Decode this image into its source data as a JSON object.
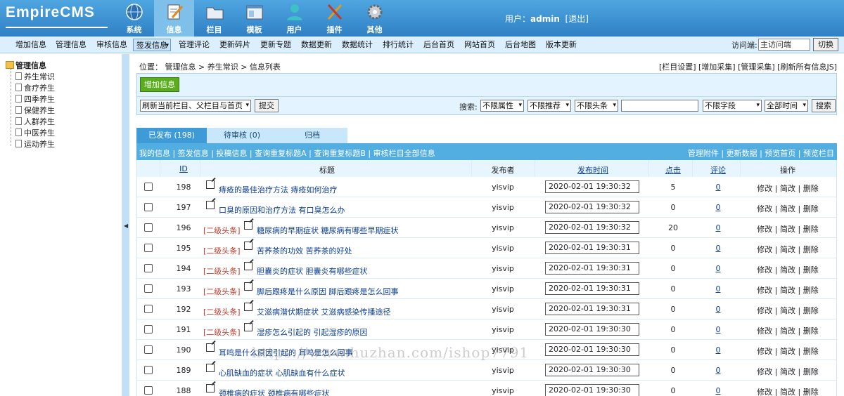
{
  "logo": "EmpireCMS",
  "topnav": [
    {
      "label": "系统",
      "icon": "globe-icon",
      "active": false
    },
    {
      "label": "信息",
      "icon": "pencil-note-icon",
      "active": true
    },
    {
      "label": "栏目",
      "icon": "folder-icon",
      "active": false
    },
    {
      "label": "模板",
      "icon": "window-icon",
      "active": false
    },
    {
      "label": "用户",
      "icon": "user-icon",
      "active": false
    },
    {
      "label": "插件",
      "icon": "tools-icon",
      "active": false
    },
    {
      "label": "其他",
      "icon": "gear-icon",
      "active": false
    }
  ],
  "user": {
    "prefix": "用户：",
    "name": "admin",
    "logout": "[退出]"
  },
  "menubar": {
    "items": [
      "增加信息",
      "管理信息",
      "审核信息",
      "签发信息",
      "管理评论",
      "更新碎片",
      "更新专题",
      "数据更新",
      "数据统计",
      "排行统计",
      "后台首页",
      "网站首页",
      "后台地图",
      "版本更新"
    ],
    "selected": "签发信息",
    "visit_label": "访问端:",
    "visit_value": "主访问端",
    "switch_label": "切换"
  },
  "tree": {
    "root": "管理信息",
    "items": [
      "养生常识",
      "食疗养生",
      "四季养生",
      "保健养生",
      "人群养生",
      "中医养生",
      "运动养生"
    ]
  },
  "breadcrumb": "位置： 管理信息 > 养生常识 > 信息列表",
  "toplinks": "[栏目设置] [增加采集] [管理采集] [刷新所有信息JS]",
  "toolbar": {
    "add_button": "增加信息",
    "refresh_select": "刷新当前栏目、父栏目与首页",
    "submit": "提交",
    "search_label": "搜索:",
    "filters": [
      "不限属性",
      "不限推荐",
      "不限头条"
    ],
    "field_select": "不限字段",
    "time_select": "全部时间",
    "search_button": "搜索"
  },
  "tabs": [
    "已发布 (198)",
    "待审核 (0)",
    "归档"
  ],
  "table_header": {
    "left": "我的信息 | 签发信息 | 投稿信息 | 查询重复标题A | 查询重复标题B | 审核栏目全部信息",
    "right": "管理附件 | 更新数据 | 预览首页 | 预览栏目"
  },
  "columns": [
    "ID",
    "标题",
    "发布者",
    "发布时间",
    "点击",
    "评论",
    "操作"
  ],
  "rows": [
    {
      "id": "198",
      "level": "",
      "title": "痔疮的最佳治疗方法 痔疮如何治疗",
      "publisher": "yisvip",
      "time": "2020-02-01 19:30:32",
      "clicks": "5",
      "comments": "0",
      "ops": "修改 | 简改 | 删除"
    },
    {
      "id": "197",
      "level": "",
      "title": "口臭的原因和治疗方法 有口臭怎么办",
      "publisher": "yisvip",
      "time": "2020-02-01 19:30:32",
      "clicks": "0",
      "comments": "0",
      "ops": "修改 | 简改 | 删除"
    },
    {
      "id": "196",
      "level": "[二级头条]",
      "title": "糖尿病的早期症状 糖尿病有哪些早期症状",
      "publisher": "yisvip",
      "time": "2020-02-01 19:30:32",
      "clicks": "20",
      "comments": "0",
      "ops": "修改 | 简改 | 删除"
    },
    {
      "id": "195",
      "level": "[二级头条]",
      "title": "苦荞茶的功效 苦荞茶的好处",
      "publisher": "yisvip",
      "time": "2020-02-01 19:30:31",
      "clicks": "0",
      "comments": "0",
      "ops": "修改 | 简改 | 删除"
    },
    {
      "id": "194",
      "level": "[二级头条]",
      "title": "胆囊炎的症状 胆囊炎有哪些症状",
      "publisher": "yisvip",
      "time": "2020-02-01 19:30:31",
      "clicks": "0",
      "comments": "0",
      "ops": "修改 | 简改 | 删除"
    },
    {
      "id": "193",
      "level": "[二级头条]",
      "title": "脚后跟疼是什么原因 脚后跟疼是怎么回事",
      "publisher": "yisvip",
      "time": "2020-02-01 19:30:31",
      "clicks": "0",
      "comments": "0",
      "ops": "修改 | 简改 | 删除"
    },
    {
      "id": "192",
      "level": "[二级头条]",
      "title": "艾滋病潜伏期症状 艾滋病感染传播途径",
      "publisher": "yisvip",
      "time": "2020-02-01 19:30:31",
      "clicks": "0",
      "comments": "0",
      "ops": "修改 | 简改 | 删除"
    },
    {
      "id": "191",
      "level": "[二级头条]",
      "title": "湿疹怎么引起的 引起湿疹的原因",
      "publisher": "yisvip",
      "time": "2020-02-01 19:30:30",
      "clicks": "0",
      "comments": "0",
      "ops": "修改 | 简改 | 删除"
    },
    {
      "id": "190",
      "level": "",
      "title": "耳鸣是什么原因引起的 耳鸣是怎么回事",
      "publisher": "yisvip",
      "time": "2020-02-01 19:30:30",
      "clicks": "0",
      "comments": "0",
      "ops": "修改 | 简改 | 删除"
    },
    {
      "id": "189",
      "level": "",
      "title": "心肌缺血的症状 心肌缺血有什么症状",
      "publisher": "yisvip",
      "time": "2020-02-01 19:30:30",
      "clicks": "0",
      "comments": "0",
      "ops": "修改 | 简改 | 删除"
    },
    {
      "id": "188",
      "level": "",
      "title": "颈椎病的症状 颈椎病有哪些症状",
      "publisher": "yisvip",
      "time": "2020-02-01 19:30:30",
      "clicks": "0",
      "comments": "0",
      "ops": "修改 | 简改 | 删除"
    }
  ],
  "watermark": "https://www.huzhan.com/ishop7791"
}
